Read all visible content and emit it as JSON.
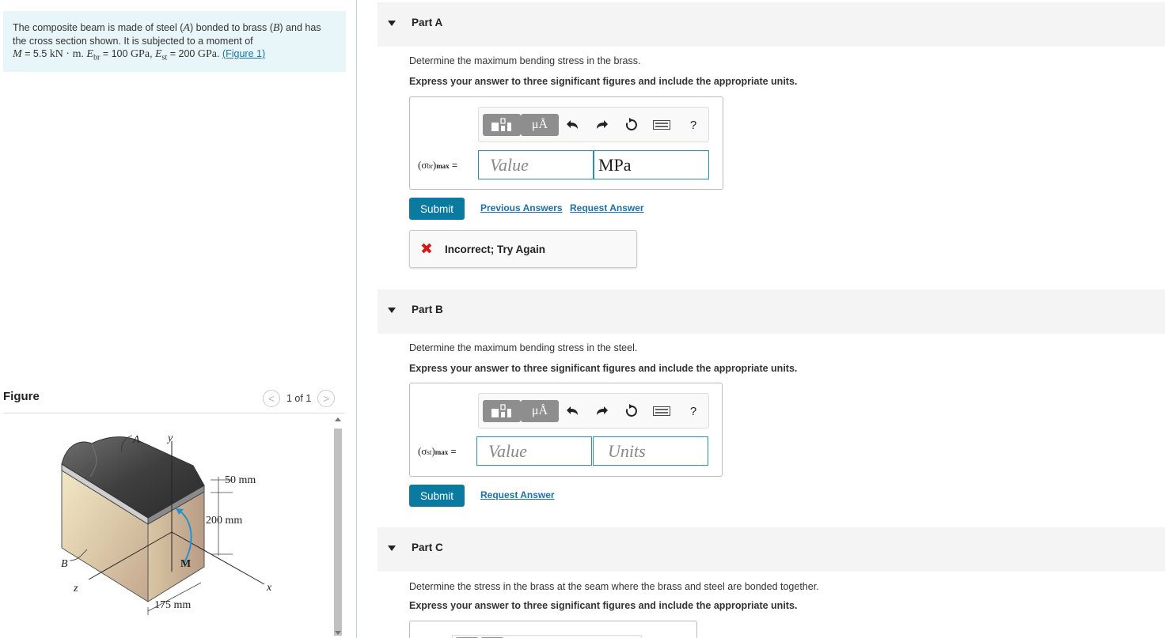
{
  "problem": {
    "text_1": "The composite beam is made of steel (",
    "steel_symbol": "A",
    "text_2": ") bonded to brass (",
    "brass_symbol": "B",
    "text_3": ") and has the cross section shown. It is subjected to a moment of",
    "moment_symbol": "M",
    "moment_value": "= 5.5",
    "moment_unit": "kN · m",
    "ebr_symbol": "E",
    "ebr_sub": "br",
    "ebr_value": "= 100",
    "gpa": "GPa",
    "est_symbol": "E",
    "est_sub": "st",
    "est_value": "= 200",
    "figure_link": "(Figure 1)"
  },
  "figure": {
    "title": "Figure",
    "pager_text": "1 of 1",
    "prev_symbol": "<",
    "next_symbol": ">",
    "labels": {
      "A": "A",
      "y": "y",
      "dim_50": "50 mm",
      "dim_200": "200 mm",
      "B": "B",
      "M": "M",
      "z": "z",
      "x": "x",
      "dim_175": "175 mm"
    }
  },
  "toolbar": {
    "units_button": "μÅ",
    "help": "?"
  },
  "parts": [
    {
      "title": "Part A",
      "prompt": "Determine the maximum bending stress in the brass.",
      "instruction": "Express your answer to three significant figures and include the appropriate units.",
      "var_main": "(σ",
      "var_sub": "br",
      "var_close": ")",
      "var_max": "max",
      "equals": "=",
      "value_placeholder": "Value",
      "unit_value": "MPa",
      "submit": "Submit",
      "previous_answers": "Previous Answers",
      "request_answer": "Request Answer",
      "feedback": "Incorrect; Try Again"
    },
    {
      "title": "Part B",
      "prompt": "Determine the maximum bending stress in the steel.",
      "instruction": "Express your answer to three significant figures and include the appropriate units.",
      "var_main": "(σ",
      "var_sub": "st",
      "var_close": ")",
      "var_max": "max",
      "equals": "=",
      "value_placeholder": "Value",
      "unit_placeholder": "Units",
      "submit": "Submit",
      "request_answer": "Request Answer"
    },
    {
      "title": "Part C",
      "prompt": "Determine the stress in the brass at the seam where the brass and steel are bonded together.",
      "instruction": "Express your answer to three significant figures and include the appropriate units."
    }
  ],
  "colors": {
    "problem_bg": "#e8f6f9",
    "submit_bg": "#0a7aa1",
    "link": "#1a73a8",
    "error": "#d21a1a",
    "field_border": "#2f8fb0"
  }
}
